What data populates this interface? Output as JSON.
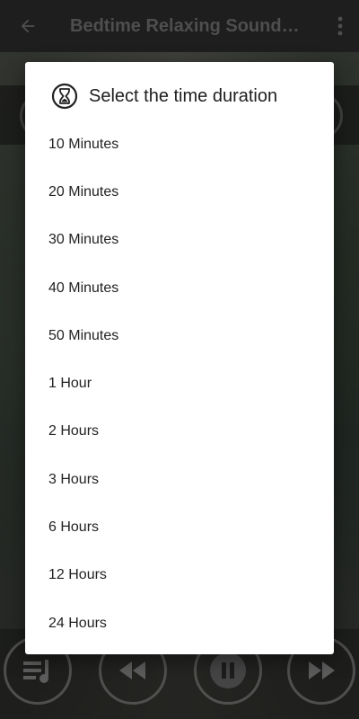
{
  "app_bar": {
    "title": "Bedtime Relaxing Sounds - Sleep Music",
    "back_icon": "arrow-back-icon",
    "menu_icon": "more-vert-icon"
  },
  "dialog": {
    "icon": "hourglass-icon",
    "title": "Select the time duration",
    "options": [
      "10 Minutes",
      "20 Minutes",
      "30 Minutes",
      "40 Minutes",
      "50 Minutes",
      "1 Hour",
      "2 Hours",
      "3 Hours",
      "6 Hours",
      "12 Hours",
      "24 Hours"
    ]
  },
  "player_controls": {
    "icons": [
      "playlist-music-icon",
      "rewind-icon",
      "pause-icon",
      "fast-forward-icon"
    ]
  },
  "colors": {
    "app_bar": "#3d3d3d",
    "dialog_bg": "#ffffff",
    "scrim": "rgba(0,0,0,0.5)"
  }
}
